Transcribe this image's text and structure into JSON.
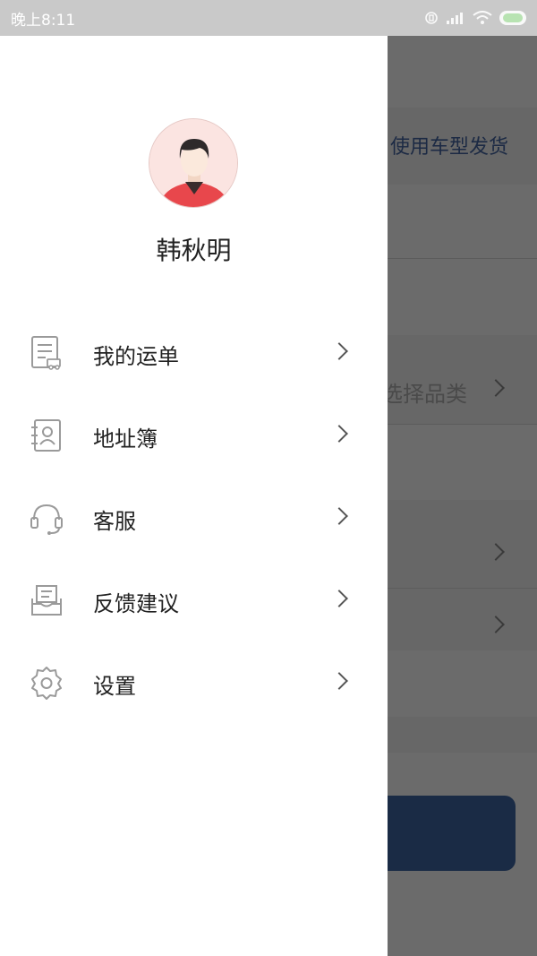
{
  "status_bar": {
    "time": "晚上8:11"
  },
  "background": {
    "header_text": "使用车型发货",
    "category_text": "选择品类",
    "button_color": "#1a2b45"
  },
  "drawer": {
    "user": {
      "name": "韩秋明"
    },
    "menu": [
      {
        "label": "我的运单",
        "icon": "waybill-icon"
      },
      {
        "label": "地址簿",
        "icon": "address-book-icon"
      },
      {
        "label": "客服",
        "icon": "headset-icon"
      },
      {
        "label": "反馈建议",
        "icon": "feedback-icon"
      },
      {
        "label": "设置",
        "icon": "settings-icon"
      }
    ]
  }
}
